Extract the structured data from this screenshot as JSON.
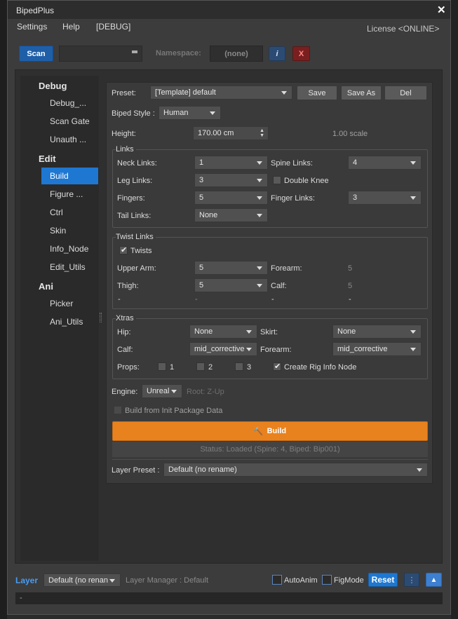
{
  "window": {
    "title": "BipedPlus",
    "close_icon": "close-icon"
  },
  "menu": {
    "settings": "Settings",
    "help": "Help",
    "debug": "[DEBUG]",
    "license": "License <ONLINE>"
  },
  "toolbar": {
    "scan": "Scan",
    "namespace_label": "Namespace:",
    "namespace_value": "(none)",
    "info": "i",
    "clear": "X"
  },
  "sidebar": {
    "groups": [
      {
        "label": "Debug",
        "items": [
          "Debug_...",
          "Scan Gate",
          "Unauth ..."
        ]
      },
      {
        "label": "Edit",
        "items": [
          "Build",
          "Figure ...",
          "Ctrl",
          "Skin",
          "Info_Node",
          "Edit_Utils"
        ]
      },
      {
        "label": "Ani",
        "items": [
          "Picker",
          "Ani_Utils"
        ]
      }
    ],
    "selected": "Build"
  },
  "preset": {
    "label": "Preset:",
    "value": "[Template] default",
    "save": "Save",
    "save_as": "Save As",
    "del": "Del"
  },
  "biped_style": {
    "label": "Biped Style :",
    "value": "Human"
  },
  "height": {
    "label": "Height:",
    "value": "170.00 cm",
    "scale": "1.00 scale"
  },
  "links": {
    "title": "Links",
    "neck_label": "Neck Links:",
    "neck": "1",
    "spine_label": "Spine Links:",
    "spine": "4",
    "leg_label": "Leg Links:",
    "leg": "3",
    "double_knee": "Double Knee",
    "double_knee_checked": false,
    "fingers_label": "Fingers:",
    "fingers": "5",
    "finger_links_label": "Finger Links:",
    "finger_links": "3",
    "tail_label": "Tail Links:",
    "tail": "None"
  },
  "twist": {
    "title": "Twist Links",
    "twists": "Twists",
    "twists_checked": true,
    "upper_arm_label": "Upper Arm:",
    "upper_arm": "5",
    "forearm_label": "Forearm:",
    "forearm": "5",
    "thigh_label": "Thigh:",
    "thigh": "5",
    "calf_label": "Calf:",
    "calf": "5",
    "dash": "-"
  },
  "xtras": {
    "title": "Xtras",
    "hip_label": "Hip:",
    "hip": "None",
    "skirt_label": "Skirt:",
    "skirt": "None",
    "calf_label": "Calf:",
    "calf": "mid_corrective",
    "forearm_label": "Forearm:",
    "forearm": "mid_corrective",
    "props_label": "Props:",
    "prop1": "1",
    "prop2": "2",
    "prop3": "3",
    "create_rig": "Create Rig Info Node",
    "create_rig_checked": true
  },
  "engine": {
    "label": "Engine:",
    "value": "Unreal",
    "root": "Root: Z-Up"
  },
  "build_init": {
    "label": "Build from Init Package Data",
    "checked": false
  },
  "build": {
    "label": "Build",
    "icon": "hammer-icon",
    "color": "#e8821e"
  },
  "status": {
    "text": "Status: Loaded (Spine: 4, Biped: Bip001)"
  },
  "layer_preset": {
    "label": "Layer Preset :",
    "value": "Default (no rename)"
  },
  "footer": {
    "layer_label": "Layer",
    "layer_value": "Default (no renan",
    "layer_manager": "Layer Manager : Default",
    "autoanim": "AutoAnim",
    "figmode": "FigMode",
    "reset": "Reset",
    "more": "⋮",
    "up": "▲",
    "console": "-"
  },
  "colors": {
    "accent": "#1e78d2",
    "build": "#e8821e",
    "clear": "#7a1f1f"
  }
}
